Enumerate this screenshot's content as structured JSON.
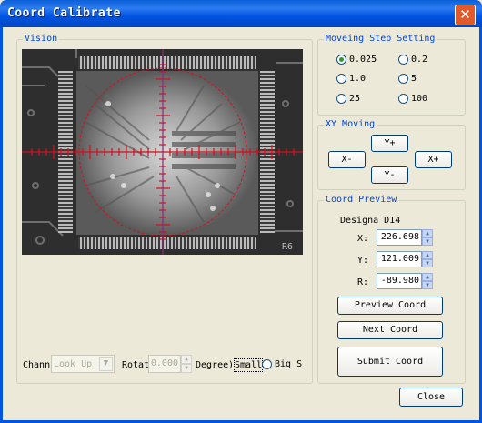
{
  "window": {
    "title": "Coord Calibrate"
  },
  "vision": {
    "group_label": "Vision",
    "overlay_text": "R6"
  },
  "controls": {
    "channel_label": "Chann",
    "channel_value": "Look Up",
    "rotate_label": "Rotat",
    "rotate_value": "0.000",
    "degree_label": "Degree",
    "small_label": "Small",
    "big_label": "Big S"
  },
  "step": {
    "group_label": "Moveing Step Setting",
    "options": [
      "0.025",
      "0.2",
      "1.0",
      "5",
      "25",
      "100"
    ],
    "selected": "0.025"
  },
  "xy": {
    "group_label": "XY Moving",
    "y_plus": "Y+",
    "x_minus": "X-",
    "x_plus": "X+",
    "y_minus": "Y-"
  },
  "preview": {
    "group_label": "Coord Preview",
    "designator": "Designa D14",
    "x_label": "X:",
    "x_value": "226.698",
    "y_label": "Y:",
    "y_value": "121.009",
    "r_label": "R:",
    "r_value": "-89.980",
    "preview_btn": "Preview Coord",
    "next_btn": "Next Coord",
    "submit_btn": "Submit Coord"
  },
  "close_btn": "Close",
  "colors": {
    "title_bar": "#0054e3",
    "group_label": "#0046d5",
    "reticle": "#d01020",
    "body": "#ece9d8"
  }
}
